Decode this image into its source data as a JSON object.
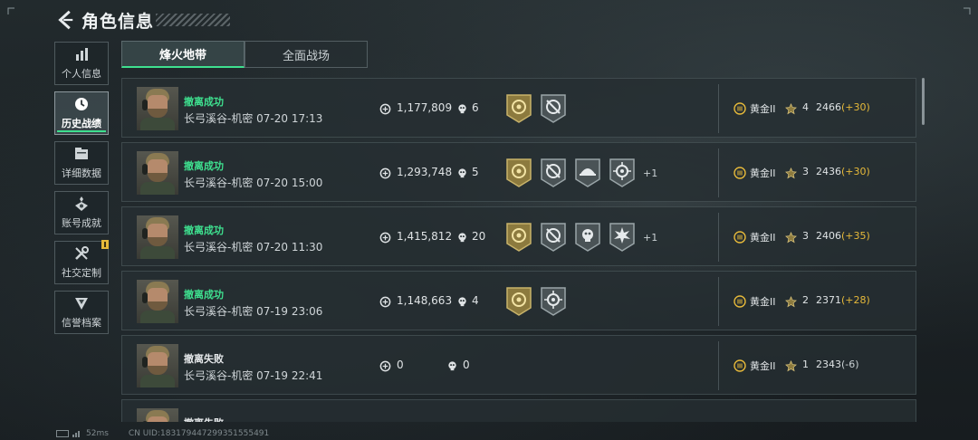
{
  "header": {
    "title": "角色信息"
  },
  "sidebar": {
    "items": [
      {
        "label": "个人信息",
        "icon": "bar-chart-icon"
      },
      {
        "label": "历史战绩",
        "icon": "clock-icon"
      },
      {
        "label": "详细数据",
        "icon": "folder-icon"
      },
      {
        "label": "账号成就",
        "icon": "achievement-icon"
      },
      {
        "label": "社交定制",
        "icon": "tools-icon"
      },
      {
        "label": "信誉档案",
        "icon": "shield-icon"
      }
    ],
    "active_index": 1
  },
  "tabs": [
    {
      "label": "烽火地带",
      "active": true
    },
    {
      "label": "全面战场",
      "active": false
    }
  ],
  "rows": [
    {
      "status": "撤离成功",
      "success": true,
      "map_time": "长弓溪谷-机密 07-20 17:13",
      "value": "1,177,809",
      "kills": "6",
      "medals": [
        "gold-medal-icon",
        "crosshair-medal-icon"
      ],
      "more": "",
      "rank": "黄金II",
      "stars": "4",
      "score": "2466",
      "delta": "(+30)"
    },
    {
      "status": "撤离成功",
      "success": true,
      "map_time": "长弓溪谷-机密 07-20 15:00",
      "value": "1,293,748",
      "kills": "5",
      "medals": [
        "gold-medal-icon",
        "crosshair-medal-icon",
        "helmet-medal-icon",
        "target-medal-icon"
      ],
      "more": "+1",
      "rank": "黄金II",
      "stars": "3",
      "score": "2436",
      "delta": "(+30)"
    },
    {
      "status": "撤离成功",
      "success": true,
      "map_time": "长弓溪谷-机密 07-20 11:30",
      "value": "1,415,812",
      "kills": "20",
      "medals": [
        "gold-medal-icon",
        "crosshair-medal-icon",
        "skull-medal-icon",
        "burst-medal-icon"
      ],
      "more": "+1",
      "rank": "黄金II",
      "stars": "3",
      "score": "2406",
      "delta": "(+35)"
    },
    {
      "status": "撤离成功",
      "success": true,
      "map_time": "长弓溪谷-机密 07-19 23:06",
      "value": "1,148,663",
      "kills": "4",
      "medals": [
        "gold-medal-icon",
        "target-medal-icon"
      ],
      "more": "",
      "rank": "黄金II",
      "stars": "2",
      "score": "2371",
      "delta": "(+28)"
    },
    {
      "status": "撤离失败",
      "success": false,
      "map_time": "长弓溪谷-机密 07-19 22:41",
      "value": "0",
      "kills": "0",
      "medals": [],
      "more": "",
      "rank": "黄金II",
      "stars": "1",
      "score": "2343",
      "delta": "(-6)"
    },
    {
      "status": "撤离失败",
      "success": false,
      "map_time": "",
      "value": "",
      "kills": "",
      "medals": [],
      "more": "",
      "rank": "",
      "stars": "",
      "score": "",
      "delta": ""
    }
  ],
  "footer": {
    "ping": "52ms",
    "uid": "CN UID:1831794472993515554​91"
  },
  "colors": {
    "accent": "#3ee08f",
    "gold": "#e6b93a"
  }
}
